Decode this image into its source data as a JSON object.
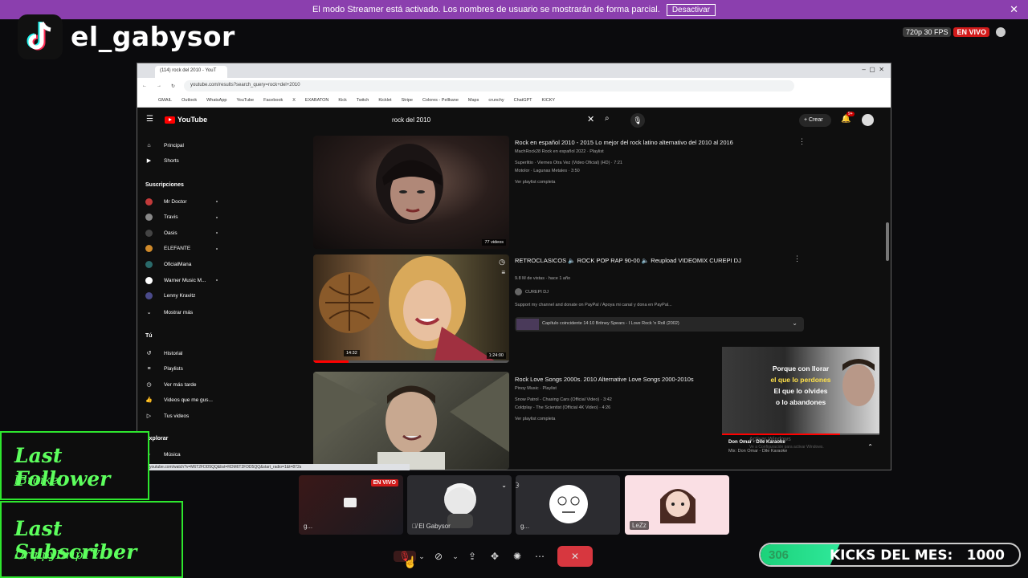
{
  "streamer_bar": {
    "message": "El modo Streamer está activado. Los nombres de usuario se mostrarán de forma parcial.",
    "button": "Desactivar",
    "close": "✕"
  },
  "overlay": {
    "name": "el_gabysor",
    "quality": "720p 30 FPS",
    "live": "EN VIVO"
  },
  "browser": {
    "tab_title": "(114) rock del 2010 - YouT",
    "url": "youtube.com/results?search_query=rock+del+2010",
    "bookmarks": [
      "GMAIL",
      "Outlook",
      "WhatsApp",
      "YouTube",
      "Facebook",
      "X",
      "EXABATON",
      "Kick",
      "Twitch",
      "Kicklet",
      "Stripe",
      "Colores - Pellkane",
      "Maps",
      "crunchy",
      "ChatGPT",
      "KICKY"
    ]
  },
  "youtube": {
    "logo": "YouTube",
    "search_query": "rock del 2010",
    "create_label": "Crear",
    "notif_count": "9+",
    "sidebar": {
      "main": [
        "Principal",
        "Shorts"
      ],
      "subs_header": "Suscripciones",
      "subs": [
        "Mr Doctor",
        "Travis",
        "Oasis",
        "ELEFANTE",
        "OficialMana",
        "Warner Music M...",
        "Lenny Kravitz"
      ],
      "show_more": "Mostrar más",
      "you_header": "Tú",
      "you": [
        "Historial",
        "Playlists",
        "Ver más tarde",
        "Videos que me gus...",
        "Tus videos"
      ],
      "explore_header": "Explorar",
      "explore": [
        "Música"
      ]
    },
    "results": [
      {
        "title": "Rock en español 2010 - 2015 Lo mejor del rock latino alternativo del 2010 al 2016",
        "channel": "MachRock28 Rock en español 2022 · Playlist",
        "lines": [
          "Superlitio · Viernes Otra Vez (Video Oficial) (HD) · 7:21",
          "Motolor · Lagunas Metales · 3:50"
        ],
        "more": "Ver playlist completa",
        "count": "77 videos"
      },
      {
        "title": "RETROCLASICOS 🔈 ROCK POP RAP 90-00 🔈 Reupload VIDEOMIX CUREPI DJ",
        "meta": "9.8 M de vistas · hace 1 año",
        "channel": "CUREPI DJ",
        "desc": "Support my channel and donate on PayPal / Apoya mi canal y dona en PayPal...",
        "chapter": "Capítulo coincidente  14:10 Britney Spears - I Love Rock 'n Roll (2002)",
        "progress_time": "14:32",
        "duration": "1:24:00"
      },
      {
        "title": "Rock Love Songs 2000s. 2010 Alternative Love Songs 2000-2010s",
        "channel": "Pinoy Music · Playlist",
        "lines": [
          "Snow Patrol - Chasing Cars (Official Video) · 3:42",
          "Coldplay - The Scientist (Official 4K Video) · 4:26"
        ],
        "more": "Ver playlist completa"
      }
    ],
    "mini_player": {
      "lines": [
        "Porque con llorar",
        "el que lo perdones",
        "El que lo olvides",
        "o lo abandones"
      ],
      "title": "Don Omar - Dile Karaoke",
      "subtitle": "Mix: Don Omar - Dile Karaoke",
      "watermark": "Activar Windows",
      "watermark_sub": "Ve a Configuración para activar Windows."
    }
  },
  "status_url": "youtube.com/watch?v=M6T2FDD5QQ&list=RDM6T2FDD5QQ&start_radio=1&t=872s",
  "last_follower": {
    "label": "Last Follower",
    "name": "lBraikel"
  },
  "last_subscriber": {
    "label": "Last Subscriber",
    "name": "DrippyDripTV"
  },
  "call": {
    "tiles": [
      {
        "label": "g...",
        "badge": "EN VIVO"
      },
      {
        "label": "El Gabysor"
      },
      {
        "label": "g..."
      },
      {
        "label": "LeZz"
      }
    ]
  },
  "kicks": {
    "count": "306",
    "label": "KICKS DEL MES:",
    "goal": "1000",
    "progress": 0.306
  },
  "colors": {
    "streamer_bar": "#8b3fae",
    "overlay_green": "#5dff5d",
    "live_red": "#d21b1b",
    "yt_red": "#ff0000"
  }
}
